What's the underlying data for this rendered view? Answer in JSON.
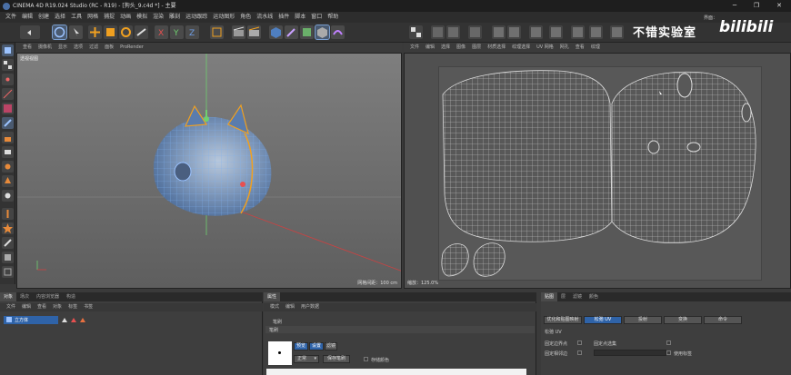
{
  "window": {
    "title": "CINEMA 4D R19.024 Studio (RC - R19) - [狗头_9.c4d *] - 主要",
    "minimize": "─",
    "maximize": "❐",
    "close": "✕"
  },
  "menu": [
    "文件",
    "编辑",
    "创建",
    "选择",
    "工具",
    "网格",
    "捕捉",
    "动画",
    "模拟",
    "渲染",
    "雕刻",
    "运动跟踪",
    "运动图形",
    "角色",
    "流水线",
    "插件",
    "脚本",
    "窗口",
    "帮助"
  ],
  "watermark": {
    "text": "不错实验室",
    "logo": "bilibili",
    "top": "界面："
  },
  "viewport_left": {
    "menu": [
      "查看",
      "摄像机",
      "显示",
      "选项",
      "过滤",
      "面板",
      "ProRender"
    ],
    "label": "透视视图",
    "grid_label": "网格间距：100 cm"
  },
  "viewport_right": {
    "menu": [
      "文件",
      "编辑",
      "选择",
      "图像",
      "图层",
      "材质选择",
      "纹理选择",
      "UV 网格",
      "网孔",
      "查看",
      "纹理"
    ],
    "status": "缩放：125.0%"
  },
  "object_panel": {
    "tabs": [
      "对象",
      "场次",
      "内容浏览器",
      "构造"
    ],
    "menu": [
      "文件",
      "编辑",
      "查看",
      "对象",
      "标签",
      "书签"
    ],
    "item": "立方体"
  },
  "attr_panel": {
    "tabs": [
      "属性"
    ],
    "menu": [
      "模式",
      "编辑",
      "用户数据"
    ],
    "section": "笔刷",
    "subsection": "笔刷",
    "sub_tabs": [
      "预览",
      "设置",
      "滤镜"
    ],
    "mode_value": "正常",
    "save_brush": "保存笔刷",
    "store_color": "存储颜色"
  },
  "uv_panel": {
    "tabs": [
      "贴图",
      "层",
      "滤镜",
      "颜色"
    ],
    "buttons": [
      "优化和贴图映射",
      "松弛 UV",
      "投射",
      "变换",
      "命令"
    ],
    "section": "松弛 UV",
    "fix_boundary": "固定边界点",
    "fix_selected": "固定点选集",
    "fix_shared": "固定相邻边",
    "use_tags": "使用标签"
  },
  "colors": {
    "accent": "#2f63a8",
    "mesh": "#6fa0e0",
    "seam": "#f0a020"
  }
}
